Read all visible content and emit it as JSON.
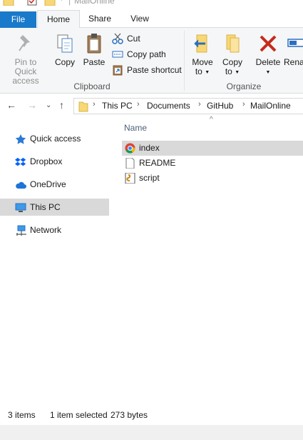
{
  "window": {
    "title": "MailOnline"
  },
  "ribbon_tabs": [
    "File",
    "Home",
    "Share",
    "View"
  ],
  "ribbon": {
    "clipboard": {
      "pin_label_1": "Pin to Quick",
      "pin_label_2": "access",
      "copy": "Copy",
      "paste": "Paste",
      "cut": "Cut",
      "copy_path": "Copy path",
      "paste_shortcut": "Paste shortcut",
      "group_label": "Clipboard"
    },
    "organize": {
      "move_1": "Move",
      "move_2": "to",
      "copy_1": "Copy",
      "copy_2": "to",
      "delete": "Delete",
      "rename": "Rena",
      "group_label": "Organize"
    }
  },
  "breadcrumb": [
    "This PC",
    "Documents",
    "GitHub",
    "MailOnline"
  ],
  "navpane": {
    "items": [
      {
        "label": "Quick access",
        "icon": "star-icon"
      },
      {
        "label": "Dropbox",
        "icon": "dropbox-icon"
      },
      {
        "label": "OneDrive",
        "icon": "cloud-icon"
      },
      {
        "label": "This PC",
        "icon": "computer-icon"
      },
      {
        "label": "Network",
        "icon": "network-icon"
      }
    ],
    "selected": "This PC"
  },
  "content": {
    "column_header": "Name",
    "files": [
      {
        "name": "index",
        "icon": "chrome-html-icon"
      },
      {
        "name": "README",
        "icon": "text-file-icon"
      },
      {
        "name": "script",
        "icon": "script-file-icon"
      }
    ],
    "selected": "index"
  },
  "status": {
    "items": "3 items",
    "selection": "1 item selected",
    "size": "273 bytes"
  },
  "colors": {
    "file_tab": "#1979ca",
    "ribbon_bg": "#f5f6f7",
    "selection": "#d9d9d9",
    "delete_red": "#c42b1c",
    "folder_yellow": "#f8d775"
  }
}
